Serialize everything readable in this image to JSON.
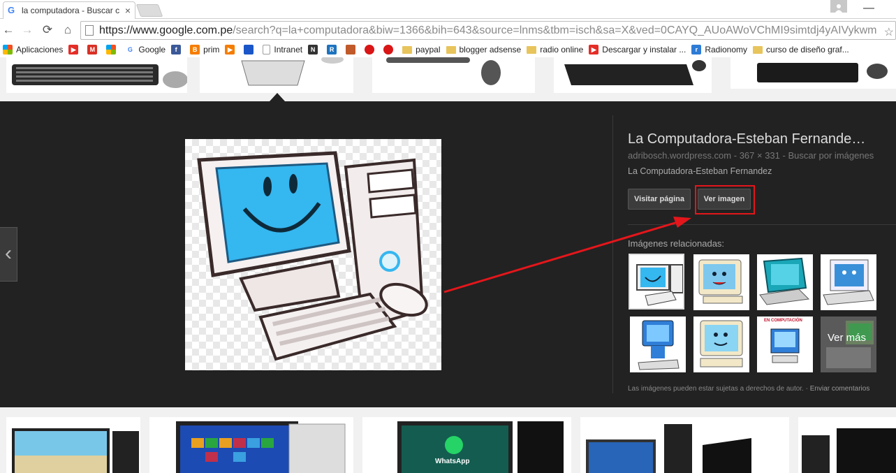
{
  "tab": {
    "title": "la computadora - Buscar c",
    "close": "×"
  },
  "toolbar": {
    "back": "←",
    "forward": "→",
    "reload": "⟳",
    "home": "⌂",
    "url_host": "https://www.google.com.pe",
    "url_path": "/search?q=la+computadora&biw=1366&bih=643&source=lnms&tbm=isch&sa=X&ved=0CAYQ_AUoAWoVChMI9simtdj4yAIVykwm",
    "star": "☆"
  },
  "bookmarks": [
    {
      "label": "Aplicaciones",
      "icon": "apps-grid-icon",
      "color": "#e8a234"
    },
    {
      "label": "",
      "icon": "youtube-icon",
      "color": "#e52d27"
    },
    {
      "label": "",
      "icon": "gmail-icon",
      "color": "#d93025"
    },
    {
      "label": "",
      "icon": "windows-icon",
      "color": "#f25022"
    },
    {
      "label": "Google",
      "icon": "google-icon",
      "color": "#4285f4"
    },
    {
      "label": "",
      "icon": "facebook-icon",
      "color": "#3b5998"
    },
    {
      "label": "prim",
      "icon": "blogger-icon",
      "color": "#f57d00"
    },
    {
      "label": "",
      "icon": "play-icon",
      "color": "#f57d00"
    },
    {
      "label": "",
      "icon": "square-icon",
      "color": "#1a56c8"
    },
    {
      "label": "Intranet",
      "icon": "page-icon",
      "color": "#9e9e9e"
    },
    {
      "label": "",
      "icon": "nw-icon",
      "color": "#333333"
    },
    {
      "label": "",
      "icon": "r-icon",
      "color": "#1e73be"
    },
    {
      "label": "",
      "icon": "bug-icon",
      "color": "#c05a2a"
    },
    {
      "label": "",
      "icon": "red-dot-icon",
      "color": "#d91515"
    },
    {
      "label": "",
      "icon": "red-dot-icon",
      "color": "#d91515"
    },
    {
      "label": "paypal",
      "icon": "folder-icon",
      "color": "#e8c45c"
    },
    {
      "label": "blogger adsense",
      "icon": "folder-icon",
      "color": "#e8c45c"
    },
    {
      "label": "radio online",
      "icon": "folder-icon",
      "color": "#e8c45c"
    },
    {
      "label": "Descargar y instalar ...",
      "icon": "youtube-icon",
      "color": "#e52d27"
    },
    {
      "label": "Radionomy",
      "icon": "radionomy-icon",
      "color": "#2e7bd6"
    },
    {
      "label": "curso de diseño graf...",
      "icon": "folder-icon",
      "color": "#e8c45c"
    }
  ],
  "panel": {
    "title": "La Computadora-Esteban Fernande…",
    "source_site": "adribosch.wordpress.com",
    "source_sep": " - ",
    "dimensions": "367 × 331",
    "search_by_image": "Buscar por imágenes",
    "description": "La Computadora-Esteban Fernandez",
    "visit_button": "Visitar página",
    "view_button": "Ver imagen",
    "related_label": "Imágenes relacionadas:",
    "more_label": "Ver más",
    "related_caption": "EN COMPUTACIÓN",
    "copyright": "Las imágenes pueden estar sujetas a derechos de autor.",
    "feedback": "Enviar comentarios",
    "prev": "‹"
  },
  "bottom": {
    "whatsapp": "WhatsApp"
  },
  "colors": {
    "highlight": "#e4161b",
    "panel_bg": "#222222",
    "screen_blue": "#35b7f0"
  }
}
